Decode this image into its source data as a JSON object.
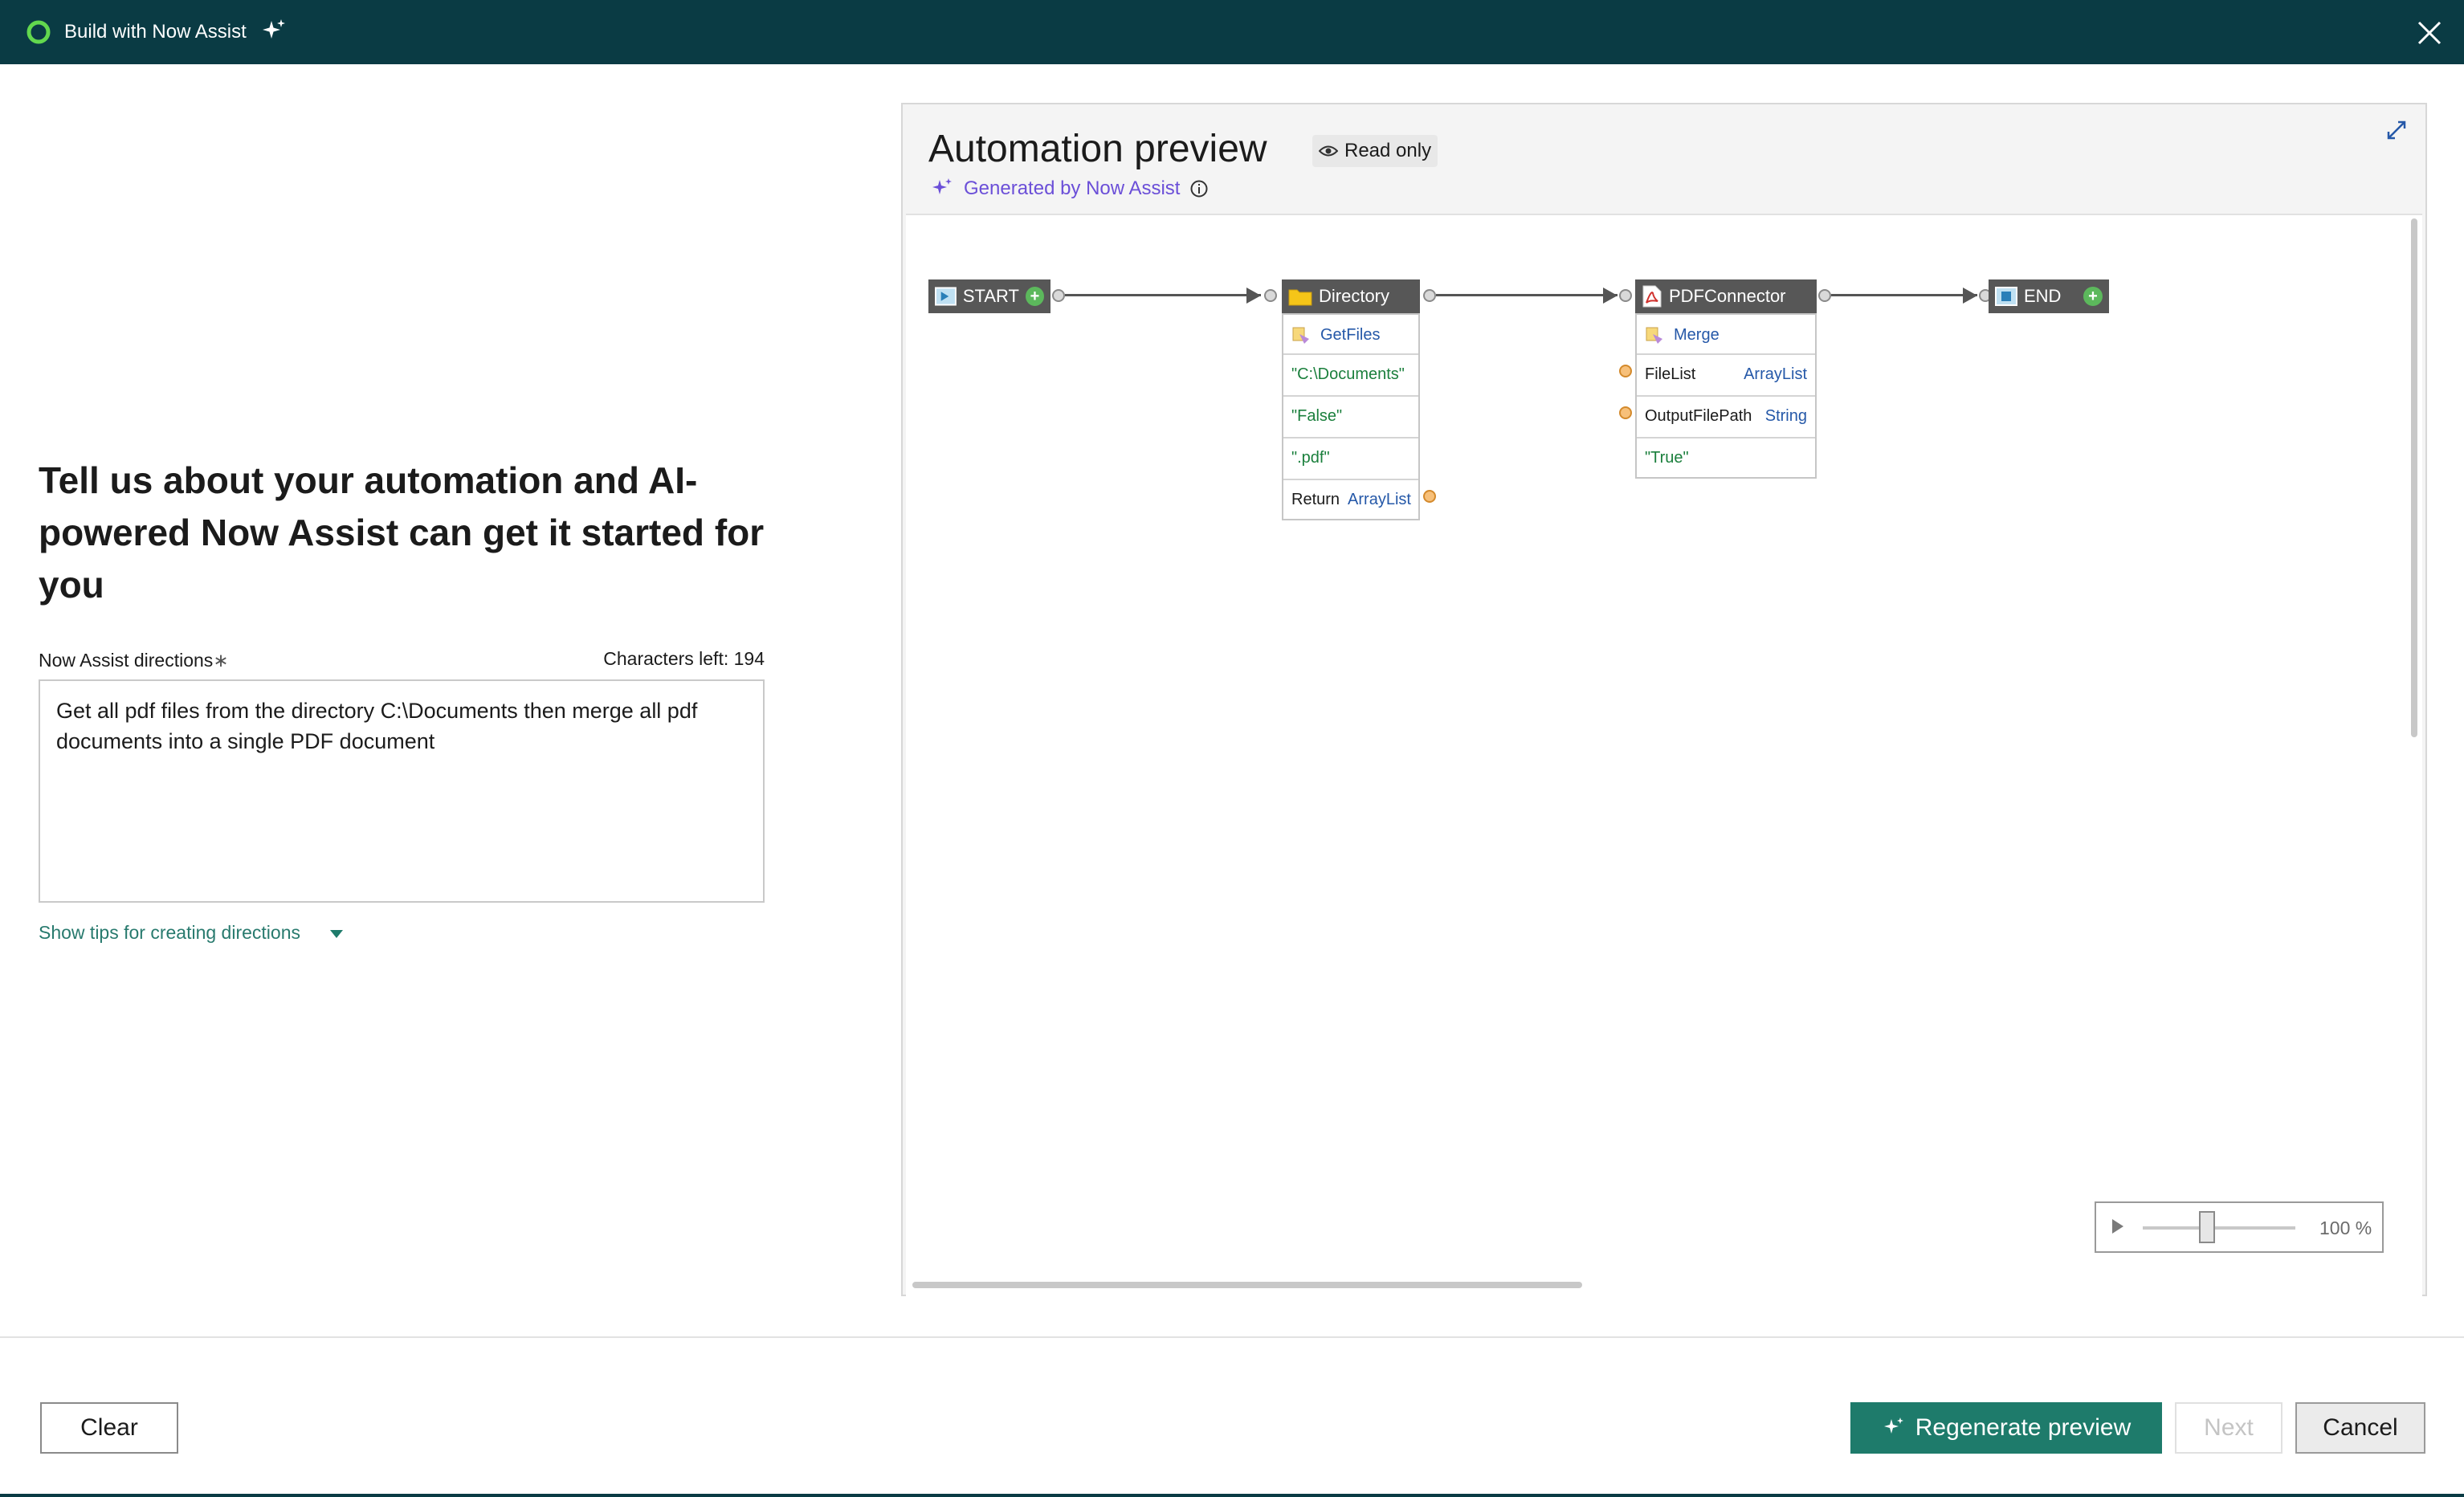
{
  "window": {
    "title": "Build with Now Assist",
    "icons": [
      "now-logo-icon",
      "sparkle-icon",
      "close-icon"
    ]
  },
  "left": {
    "heading": "Tell us about your automation and AI-powered Now Assist can get it started for you",
    "directions_label": "Now Assist directions",
    "required_mark": "∗",
    "chars_left": "Characters left: 194",
    "directions_value": "Get all pdf files from the directory C:\\Documents then merge all pdf documents into a single PDF document",
    "tips_link": "Show tips for creating directions"
  },
  "preview": {
    "title": "Automation preview",
    "read_only": "Read only",
    "generated_by": "Generated by Now Assist",
    "zoom": "100 %",
    "flow": {
      "start": "START",
      "end": "END",
      "directory": {
        "title": "Directory",
        "method": "GetFiles",
        "args": [
          "\"C:\\Documents\"",
          "\"False\"",
          "\".pdf\""
        ],
        "return_label": "Return",
        "return_type": "ArrayList"
      },
      "pdf": {
        "title": "PDFConnector",
        "method": "Merge",
        "param1_name": "FileList",
        "param1_type": "ArrayList",
        "param2_name": "OutputFilePath",
        "param2_type": "String",
        "arg": "\"True\""
      }
    }
  },
  "footer": {
    "clear": "Clear",
    "regenerate": "Regenerate preview",
    "next": "Next",
    "cancel": "Cancel"
  },
  "colors": {
    "titlebar": "#0a3b44",
    "accent_green": "#1e7b6b",
    "link_green": "#287a6e",
    "sparkle_purple": "#6b4fd8"
  }
}
